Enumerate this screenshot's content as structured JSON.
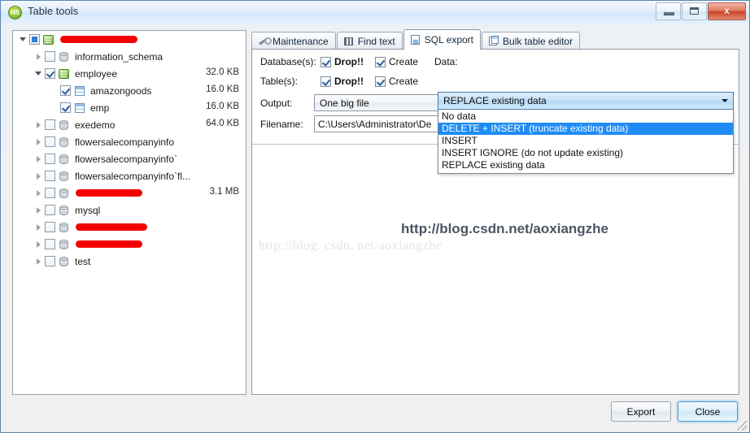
{
  "window": {
    "title": "Table tools",
    "app_icon": "HS",
    "minimize_label": "Minimize",
    "maximize_label": "Maximize",
    "close_label": "x"
  },
  "tree": {
    "rows": [
      {
        "indent": 0,
        "expander": "expanded",
        "check": "partial",
        "icon": "connection-icon",
        "label": "",
        "redacted": true,
        "redact_width": 95,
        "size": ""
      },
      {
        "indent": 1,
        "expander": "collapsed",
        "check": "unchecked",
        "icon": "database-icon",
        "label": "information_schema",
        "redacted": false,
        "redact_width": 0,
        "size": ""
      },
      {
        "indent": 1,
        "expander": "expanded",
        "check": "checked",
        "icon": "connection-icon",
        "label": "employee",
        "redacted": false,
        "redact_width": 0,
        "size": "32.0 KB"
      },
      {
        "indent": 2,
        "expander": "none",
        "check": "checked",
        "icon": "table-icon",
        "label": "amazongoods",
        "redacted": false,
        "redact_width": 0,
        "size": "16.0 KB"
      },
      {
        "indent": 2,
        "expander": "none",
        "check": "checked",
        "icon": "table-icon",
        "label": "emp",
        "redacted": false,
        "redact_width": 0,
        "size": "16.0 KB"
      },
      {
        "indent": 1,
        "expander": "collapsed",
        "check": "unchecked",
        "icon": "database-icon",
        "label": "exedemo",
        "redacted": false,
        "redact_width": 0,
        "size": "64.0 KB"
      },
      {
        "indent": 1,
        "expander": "collapsed",
        "check": "unchecked",
        "icon": "database-icon",
        "label": "flowersalecompanyinfo",
        "redacted": false,
        "redact_width": 0,
        "size": ""
      },
      {
        "indent": 1,
        "expander": "collapsed",
        "check": "unchecked",
        "icon": "database-icon",
        "label": "flowersalecompanyinfo`",
        "redacted": false,
        "redact_width": 0,
        "size": ""
      },
      {
        "indent": 1,
        "expander": "collapsed",
        "check": "unchecked",
        "icon": "database-icon",
        "label": "flowersalecompanyinfo`fl...",
        "redacted": false,
        "redact_width": 0,
        "size": ""
      },
      {
        "indent": 1,
        "expander": "collapsed",
        "check": "unchecked",
        "icon": "database-icon",
        "label": "",
        "redacted": true,
        "redact_width": 82,
        "size": "3.1 MB"
      },
      {
        "indent": 1,
        "expander": "collapsed",
        "check": "unchecked",
        "icon": "database-icon",
        "label": "mysql",
        "redacted": false,
        "redact_width": 0,
        "size": ""
      },
      {
        "indent": 1,
        "expander": "collapsed",
        "check": "unchecked",
        "icon": "database-icon",
        "label": "",
        "redacted": true,
        "redact_width": 88,
        "size": ""
      },
      {
        "indent": 1,
        "expander": "collapsed",
        "check": "unchecked",
        "icon": "database-icon",
        "label": "",
        "redacted": true,
        "redact_width": 82,
        "size": ""
      },
      {
        "indent": 1,
        "expander": "collapsed",
        "check": "unchecked",
        "icon": "database-icon",
        "label": "test",
        "redacted": false,
        "redact_width": 0,
        "size": ""
      }
    ]
  },
  "tabs": [
    {
      "label": "Maintenance",
      "icon": "wrench-icon",
      "active": false
    },
    {
      "label": "Find text",
      "icon": "binoculars-icon",
      "active": false
    },
    {
      "label": "SQL export",
      "icon": "sql-file-icon",
      "active": true
    },
    {
      "label": "Bulk table editor",
      "icon": "copy-tables-icon",
      "active": false
    }
  ],
  "form": {
    "databases_label": "Database(s):",
    "tables_label": "Table(s):",
    "output_label": "Output:",
    "filename_label": "Filename:",
    "data_label": "Data:",
    "db_drop_label": "Drop!!",
    "db_create_label": "Create",
    "tbl_drop_label": "Drop!!",
    "tbl_create_label": "Create",
    "db_drop_checked": true,
    "db_create_checked": true,
    "tbl_drop_checked": true,
    "tbl_create_checked": true,
    "output_value": "One big file",
    "filename_value": "C:\\Users\\Administrator\\De"
  },
  "data_dropdown": {
    "selected": "REPLACE existing data",
    "options": [
      "No data",
      "DELETE + INSERT (truncate existing data)",
      "INSERT",
      "INSERT IGNORE (do not update existing)",
      "REPLACE existing data"
    ],
    "highlighted": "DELETE + INSERT (truncate existing data)",
    "highlight_color": "#1f8cf5"
  },
  "watermarks": {
    "bold": "http://blog.csdn.net/aoxiangzhe",
    "light": "http://blog. csdn. net/aoxiangzhe"
  },
  "footer": {
    "export_label": "Export",
    "close_label": "Close"
  }
}
